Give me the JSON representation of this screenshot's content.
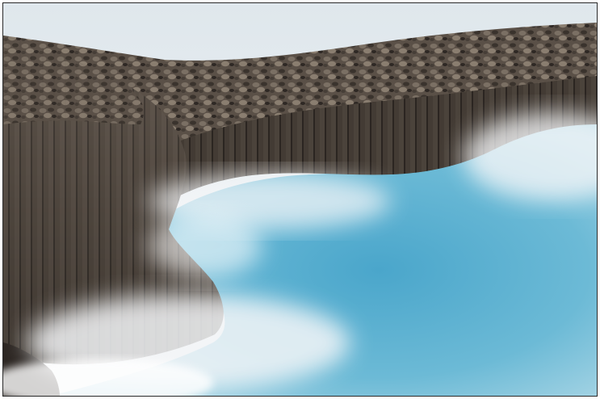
{
  "scene": {
    "subject": "basalt-columns-coastline",
    "colors": {
      "sky": "#e9eef2",
      "rock_dark": "#2f2b27",
      "rock_mid": "#5a5048",
      "rock_light": "#8d8173",
      "water": "#5fb2cf",
      "water_deep": "#3c97bd",
      "mist": "#f4f6f8",
      "frame_border": "#2a2a2a"
    }
  }
}
